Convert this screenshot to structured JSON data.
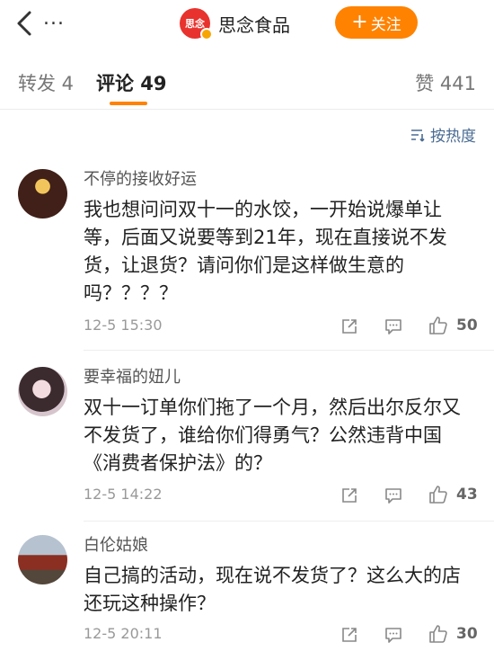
{
  "header": {
    "more_label": "...",
    "account_name": "思念食品",
    "logo_text": "思念",
    "follow_label": "关注"
  },
  "tabs": {
    "repost": "转发 4",
    "comments": "评论 49",
    "likes": "赞 441"
  },
  "sort": {
    "label": "按热度"
  },
  "comments": [
    {
      "user": "不停的接收好运",
      "text": "我也想问问双十一的水饺，一开始说爆单让等，后面又说要等到21年，现在直接说不发货，让退货？请问你们是这样做生意的吗？？？？",
      "time": "12-5 15:30",
      "likes": "50"
    },
    {
      "user": "要幸福的妞儿",
      "text": "双十一订单你们拖了一个月，然后出尔反尔又不发货了，谁给你们得勇气？公然违背中国《消费者保护法》的？",
      "time": "12-5 14:22",
      "likes": "43"
    },
    {
      "user": "白伦姑娘",
      "text": "自己搞的活动，现在说不发货了？这么大的店还玩这种操作？",
      "time": "12-5 20:11",
      "likes": "30"
    }
  ],
  "colors": {
    "accent": "#ff8200",
    "link": "#4a6b93",
    "brand": "#e8322d"
  }
}
